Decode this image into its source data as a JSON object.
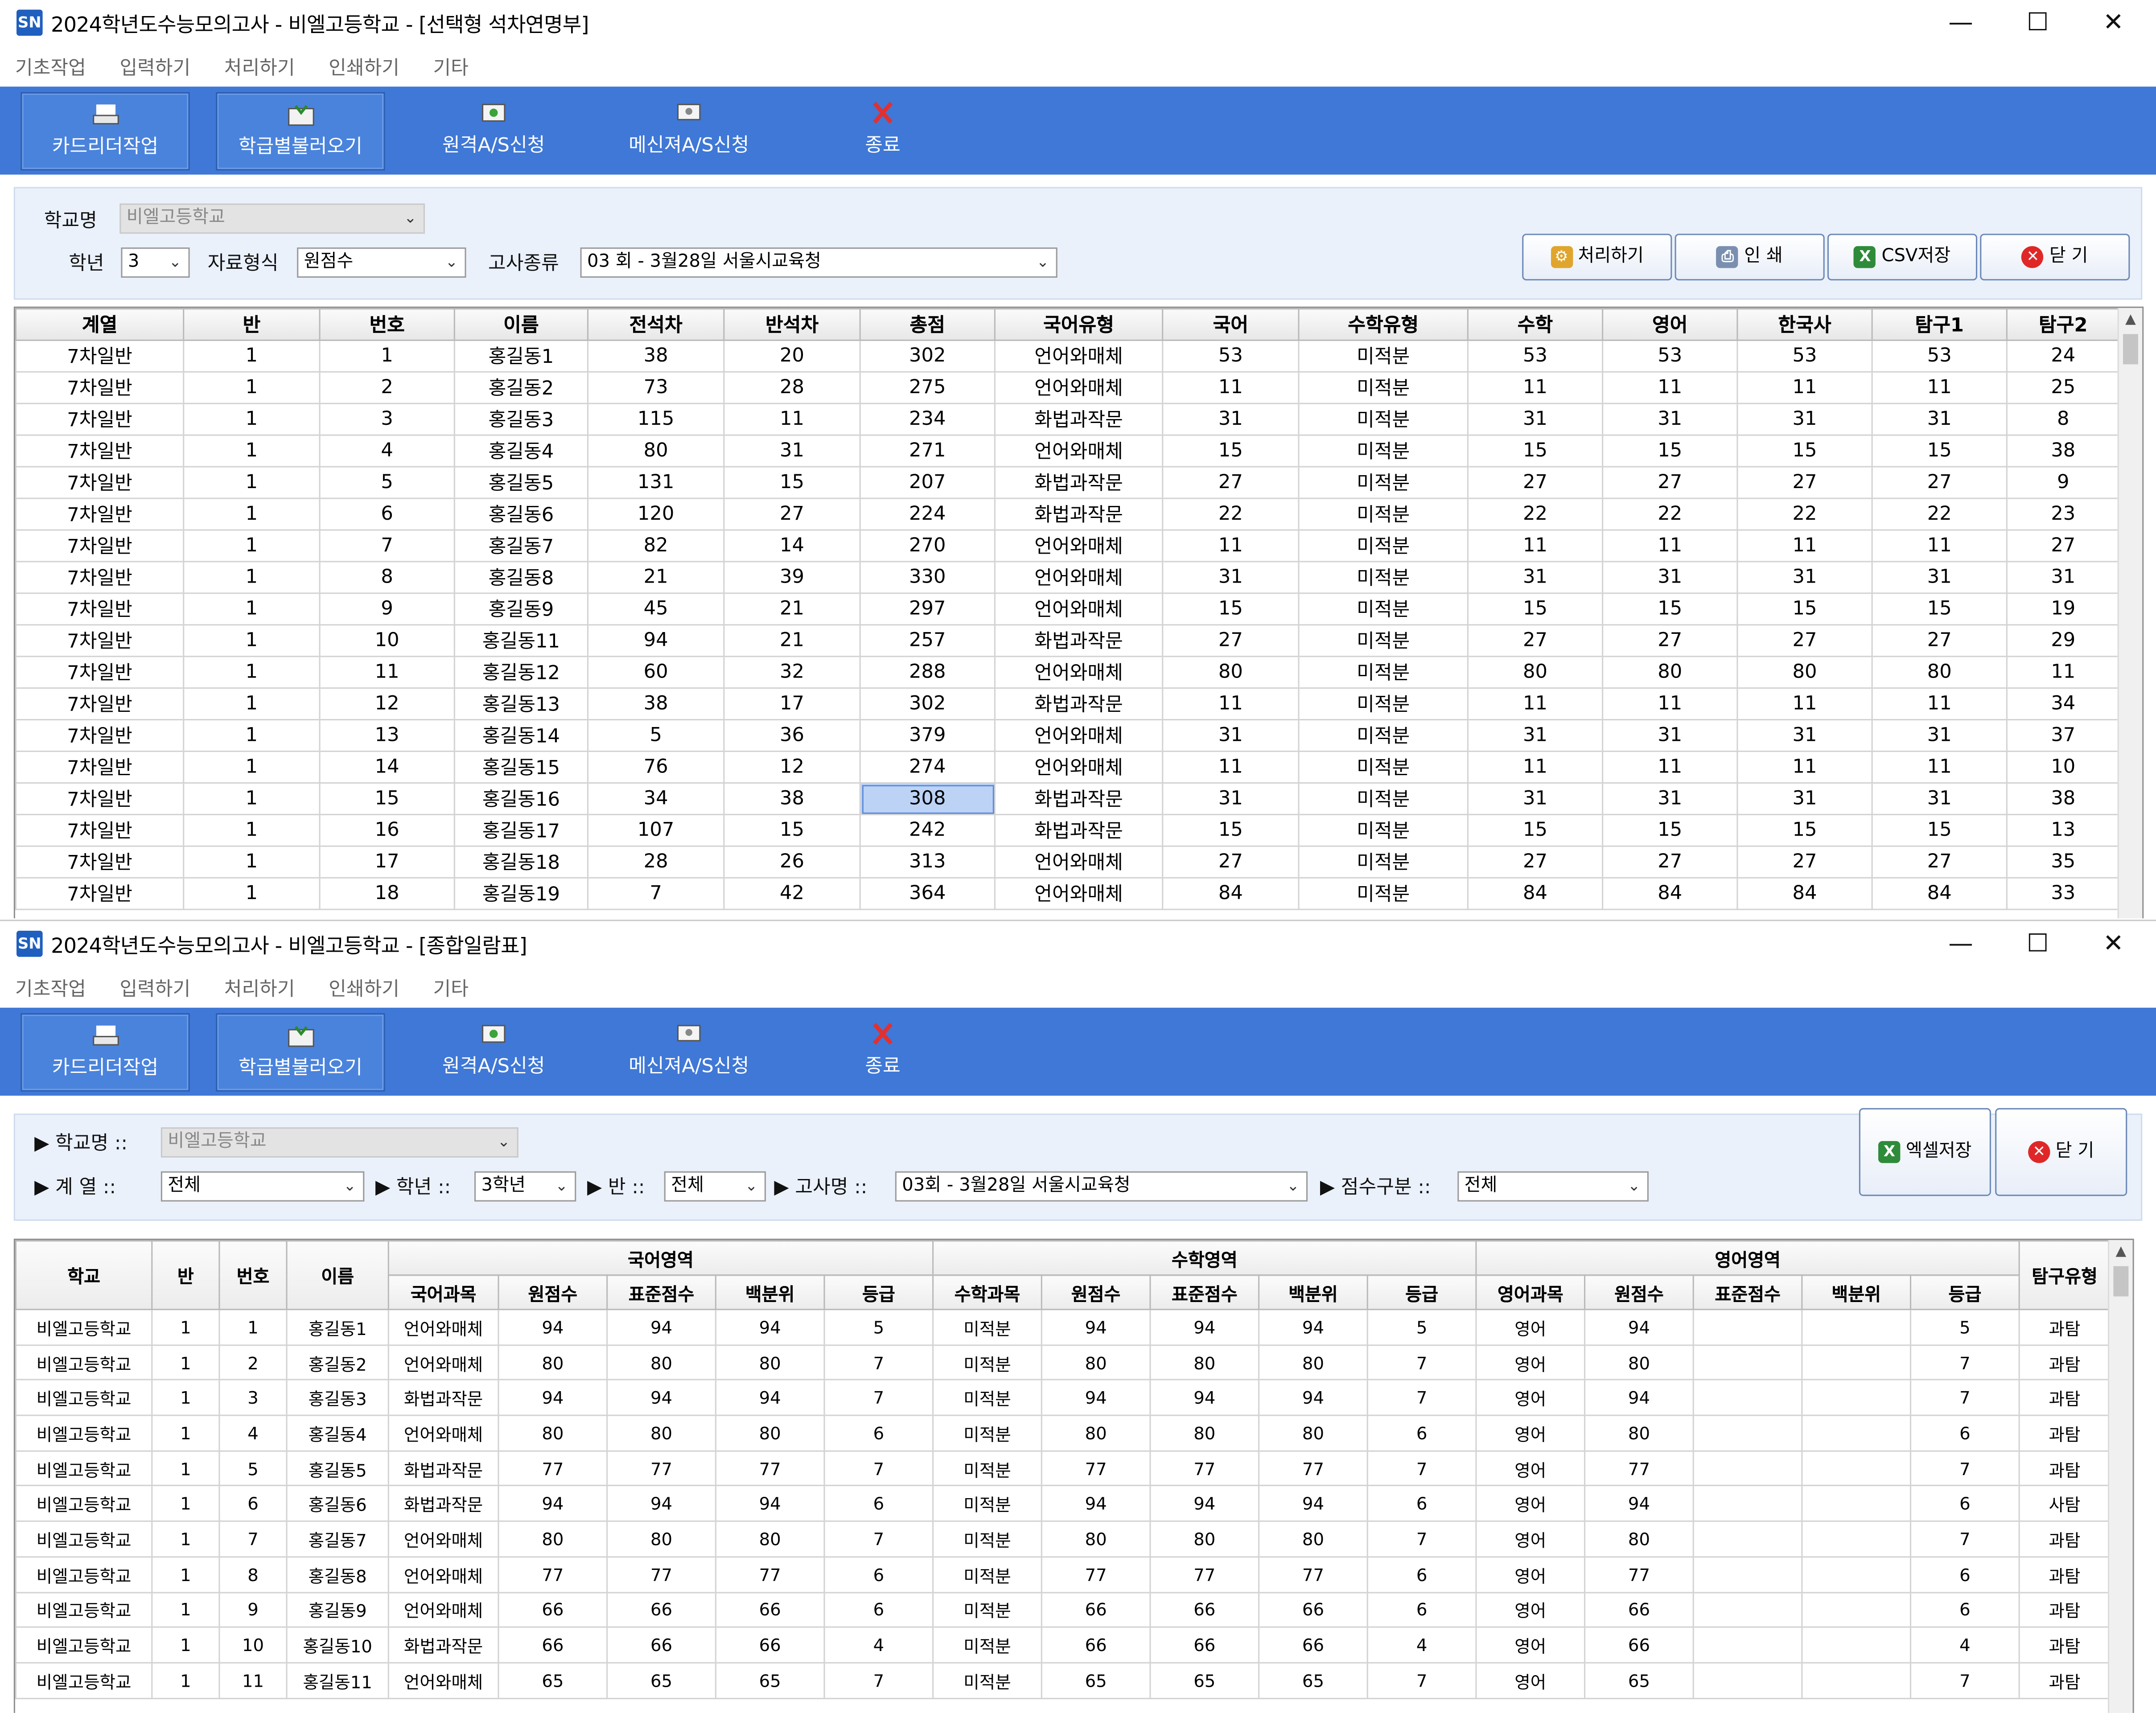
{
  "windows": [
    {
      "app_icon": "SN",
      "title": "2024학년도수능모의고사 - 비엘고등학교 - [선택형 석차연명부]",
      "controls": {
        "minimize": "—",
        "maximize": "☐",
        "close": "✕"
      },
      "menu": [
        "기초작업",
        "입력하기",
        "처리하기",
        "인쇄하기",
        "기타"
      ],
      "toolbar": [
        {
          "label": "카드리더작업",
          "icon": "card-reader-icon"
        },
        {
          "label": "학급별불러오기",
          "icon": "class-load-icon"
        },
        {
          "label": "원격A/S신청",
          "icon": "remote-as-icon"
        },
        {
          "label": "메신져A/S신청",
          "icon": "messenger-as-icon"
        },
        {
          "label": "종료",
          "icon": "exit-icon"
        }
      ],
      "filters": {
        "school_label": "학교명",
        "school_value": "비엘고등학교",
        "grade_label": "학년",
        "grade_value": "3",
        "format_label": "자료형식",
        "format_value": "원점수",
        "exam_label": "고사종류",
        "exam_value": "03 회 - 3월28일 서울시교육청"
      },
      "actions": [
        {
          "label": "처리하기",
          "icon": "process-icon"
        },
        {
          "label": "인  쇄",
          "icon": "print-icon"
        },
        {
          "label": "CSV저장",
          "icon": "csv-icon"
        },
        {
          "label": "닫  기",
          "icon": "close-circle-icon"
        }
      ],
      "table": {
        "columns": [
          "계열",
          "반",
          "번호",
          "이름",
          "전석차",
          "반석차",
          "총점",
          "국어유형",
          "국어",
          "수학유형",
          "수학",
          "영어",
          "한국사",
          "탐구1",
          "탐구2"
        ],
        "rows": [
          [
            "7차일반",
            "1",
            "1",
            "홍길동1",
            "38",
            "20",
            "302",
            "언어와매체",
            "53",
            "미적분",
            "53",
            "53",
            "53",
            "53",
            "24"
          ],
          [
            "7차일반",
            "1",
            "2",
            "홍길동2",
            "73",
            "28",
            "275",
            "언어와매체",
            "11",
            "미적분",
            "11",
            "11",
            "11",
            "11",
            "25"
          ],
          [
            "7차일반",
            "1",
            "3",
            "홍길동3",
            "115",
            "11",
            "234",
            "화법과작문",
            "31",
            "미적분",
            "31",
            "31",
            "31",
            "31",
            "8"
          ],
          [
            "7차일반",
            "1",
            "4",
            "홍길동4",
            "80",
            "31",
            "271",
            "언어와매체",
            "15",
            "미적분",
            "15",
            "15",
            "15",
            "15",
            "38"
          ],
          [
            "7차일반",
            "1",
            "5",
            "홍길동5",
            "131",
            "15",
            "207",
            "화법과작문",
            "27",
            "미적분",
            "27",
            "27",
            "27",
            "27",
            "9"
          ],
          [
            "7차일반",
            "1",
            "6",
            "홍길동6",
            "120",
            "27",
            "224",
            "화법과작문",
            "22",
            "미적분",
            "22",
            "22",
            "22",
            "22",
            "23"
          ],
          [
            "7차일반",
            "1",
            "7",
            "홍길동7",
            "82",
            "14",
            "270",
            "언어와매체",
            "11",
            "미적분",
            "11",
            "11",
            "11",
            "11",
            "27"
          ],
          [
            "7차일반",
            "1",
            "8",
            "홍길동8",
            "21",
            "39",
            "330",
            "언어와매체",
            "31",
            "미적분",
            "31",
            "31",
            "31",
            "31",
            "31"
          ],
          [
            "7차일반",
            "1",
            "9",
            "홍길동9",
            "45",
            "21",
            "297",
            "언어와매체",
            "15",
            "미적분",
            "15",
            "15",
            "15",
            "15",
            "19"
          ],
          [
            "7차일반",
            "1",
            "10",
            "홍길동11",
            "94",
            "21",
            "257",
            "화법과작문",
            "27",
            "미적분",
            "27",
            "27",
            "27",
            "27",
            "29"
          ],
          [
            "7차일반",
            "1",
            "11",
            "홍길동12",
            "60",
            "32",
            "288",
            "언어와매체",
            "80",
            "미적분",
            "80",
            "80",
            "80",
            "80",
            "11"
          ],
          [
            "7차일반",
            "1",
            "12",
            "홍길동13",
            "38",
            "17",
            "302",
            "화법과작문",
            "11",
            "미적분",
            "11",
            "11",
            "11",
            "11",
            "34"
          ],
          [
            "7차일반",
            "1",
            "13",
            "홍길동14",
            "5",
            "36",
            "379",
            "언어와매체",
            "31",
            "미적분",
            "31",
            "31",
            "31",
            "31",
            "37"
          ],
          [
            "7차일반",
            "1",
            "14",
            "홍길동15",
            "76",
            "12",
            "274",
            "언어와매체",
            "11",
            "미적분",
            "11",
            "11",
            "11",
            "11",
            "10"
          ],
          [
            "7차일반",
            "1",
            "15",
            "홍길동16",
            "34",
            "38",
            "308",
            "화법과작문",
            "31",
            "미적분",
            "31",
            "31",
            "31",
            "31",
            "38"
          ],
          [
            "7차일반",
            "1",
            "16",
            "홍길동17",
            "107",
            "15",
            "242",
            "화법과작문",
            "15",
            "미적분",
            "15",
            "15",
            "15",
            "15",
            "13"
          ],
          [
            "7차일반",
            "1",
            "17",
            "홍길동18",
            "28",
            "26",
            "313",
            "언어와매체",
            "27",
            "미적분",
            "27",
            "27",
            "27",
            "27",
            "35"
          ],
          [
            "7차일반",
            "1",
            "18",
            "홍길동19",
            "7",
            "42",
            "364",
            "언어와매체",
            "84",
            "미적분",
            "84",
            "84",
            "84",
            "84",
            "33"
          ]
        ]
      }
    },
    {
      "app_icon": "SN",
      "title": "2024학년도수능모의고사 - 비엘고등학교 - [종합일람표]",
      "controls": {
        "minimize": "—",
        "maximize": "☐",
        "close": "✕"
      },
      "menu": [
        "기초작업",
        "입력하기",
        "처리하기",
        "인쇄하기",
        "기타"
      ],
      "toolbar": [
        {
          "label": "카드리더작업",
          "icon": "card-reader-icon"
        },
        {
          "label": "학급별불러오기",
          "icon": "class-load-icon"
        },
        {
          "label": "원격A/S신청",
          "icon": "remote-as-icon"
        },
        {
          "label": "메신져A/S신청",
          "icon": "messenger-as-icon"
        },
        {
          "label": "종료",
          "icon": "exit-icon"
        }
      ],
      "filters": {
        "school_label": "▶ 학교명 ::",
        "school_value": "비엘고등학교",
        "track_label": "▶ 계  열 ::",
        "track_value": "전체",
        "grade_label": "▶ 학년 ::",
        "grade_value": "3학년",
        "class_label": "▶ 반 ::",
        "class_value": "전체",
        "exam_label": "▶ 고사명 ::",
        "exam_value": "03회 - 3월28일 서울시교육청",
        "score_label": "▶ 점수구분 ::",
        "score_value": "전체"
      },
      "actions": [
        {
          "label": "엑셀저장",
          "icon": "excel-icon"
        },
        {
          "label": "닫  기",
          "icon": "close-circle-icon"
        }
      ],
      "table": {
        "fixed_headers": [
          "학교",
          "반",
          "번호",
          "이름"
        ],
        "groups": [
          {
            "label": "국어영역",
            "sub": [
              "국어과목",
              "원점수",
              "표준점수",
              "백분위",
              "등급"
            ]
          },
          {
            "label": "수학영역",
            "sub": [
              "수학과목",
              "원점수",
              "표준점수",
              "백분위",
              "등급"
            ]
          },
          {
            "label": "영어영역",
            "sub": [
              "영어과목",
              "원점수",
              "표준점수",
              "백분위",
              "등급"
            ]
          }
        ],
        "trailing_header": "탐구유형",
        "rows": [
          [
            "비엘고등학교",
            "1",
            "1",
            "홍길동1",
            "언어와매체",
            "94",
            "94",
            "94",
            "5",
            "미적분",
            "94",
            "94",
            "94",
            "5",
            "영어",
            "94",
            "",
            "",
            "5",
            "과탐"
          ],
          [
            "비엘고등학교",
            "1",
            "2",
            "홍길동2",
            "언어와매체",
            "80",
            "80",
            "80",
            "7",
            "미적분",
            "80",
            "80",
            "80",
            "7",
            "영어",
            "80",
            "",
            "",
            "7",
            "과탐"
          ],
          [
            "비엘고등학교",
            "1",
            "3",
            "홍길동3",
            "화법과작문",
            "94",
            "94",
            "94",
            "7",
            "미적분",
            "94",
            "94",
            "94",
            "7",
            "영어",
            "94",
            "",
            "",
            "7",
            "과탐"
          ],
          [
            "비엘고등학교",
            "1",
            "4",
            "홍길동4",
            "언어와매체",
            "80",
            "80",
            "80",
            "6",
            "미적분",
            "80",
            "80",
            "80",
            "6",
            "영어",
            "80",
            "",
            "",
            "6",
            "과탐"
          ],
          [
            "비엘고등학교",
            "1",
            "5",
            "홍길동5",
            "화법과작문",
            "77",
            "77",
            "77",
            "7",
            "미적분",
            "77",
            "77",
            "77",
            "7",
            "영어",
            "77",
            "",
            "",
            "7",
            "과탐"
          ],
          [
            "비엘고등학교",
            "1",
            "6",
            "홍길동6",
            "화법과작문",
            "94",
            "94",
            "94",
            "6",
            "미적분",
            "94",
            "94",
            "94",
            "6",
            "영어",
            "94",
            "",
            "",
            "6",
            "사탐"
          ],
          [
            "비엘고등학교",
            "1",
            "7",
            "홍길동7",
            "언어와매체",
            "80",
            "80",
            "80",
            "7",
            "미적분",
            "80",
            "80",
            "80",
            "7",
            "영어",
            "80",
            "",
            "",
            "7",
            "과탐"
          ],
          [
            "비엘고등학교",
            "1",
            "8",
            "홍길동8",
            "언어와매체",
            "77",
            "77",
            "77",
            "6",
            "미적분",
            "77",
            "77",
            "77",
            "6",
            "영어",
            "77",
            "",
            "",
            "6",
            "과탐"
          ],
          [
            "비엘고등학교",
            "1",
            "9",
            "홍길동9",
            "언어와매체",
            "66",
            "66",
            "66",
            "6",
            "미적분",
            "66",
            "66",
            "66",
            "6",
            "영어",
            "66",
            "",
            "",
            "6",
            "과탐"
          ],
          [
            "비엘고등학교",
            "1",
            "10",
            "홍길동10",
            "화법과작문",
            "66",
            "66",
            "66",
            "4",
            "미적분",
            "66",
            "66",
            "66",
            "4",
            "영어",
            "66",
            "",
            "",
            "4",
            "과탐"
          ],
          [
            "비엘고등학교",
            "1",
            "11",
            "홍길동11",
            "언어와매체",
            "65",
            "65",
            "65",
            "7",
            "미적분",
            "65",
            "65",
            "65",
            "7",
            "영어",
            "65",
            "",
            "",
            "7",
            "과탐"
          ]
        ]
      }
    }
  ],
  "colors": {
    "toolbar": "#3f78d6",
    "panel": "#eaf1fb",
    "selection": "#bcd3f5"
  }
}
